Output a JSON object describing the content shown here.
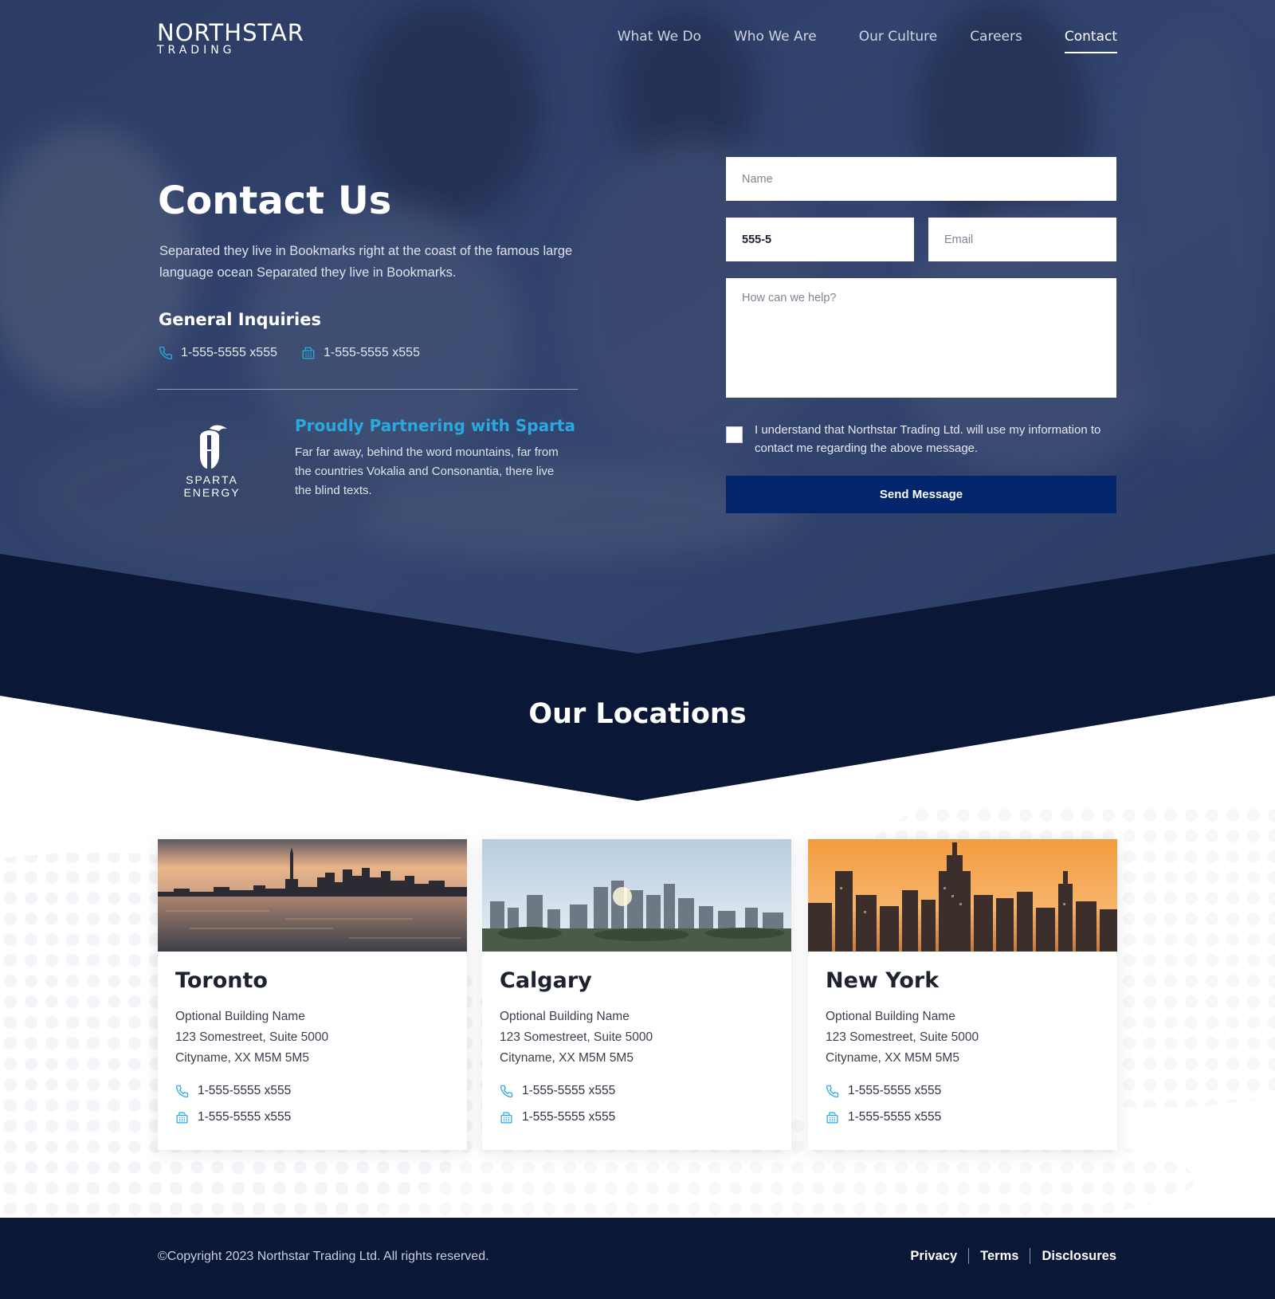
{
  "brand": {
    "name_top": "NORTHSTAR",
    "name_bottom": "TRADING"
  },
  "nav": {
    "items": [
      {
        "label": "What We Do"
      },
      {
        "label": "Who We Are"
      },
      {
        "label": "Our Culture"
      },
      {
        "label": "Careers"
      },
      {
        "label": "Contact",
        "active": true
      }
    ]
  },
  "hero": {
    "title": "Contact Us",
    "lead": "Separated they live in Bookmarks right at the coast of the famous large language ocean Separated they live in Bookmarks.",
    "inquiries_title": "General Inquiries",
    "phone": "1-555-5555 x555",
    "fax": "1-555-5555 x555"
  },
  "partner": {
    "logo_text": "SPARTA ENERGY",
    "title": "Proudly Partnering with Sparta",
    "text": "Far far away, behind the word mountains, far from the countries Vokalia and Consonantia, there live the blind texts."
  },
  "form": {
    "name_placeholder": "Name",
    "phone_value": "555-5",
    "email_placeholder": "Email",
    "message_placeholder": "How can we help?",
    "consent_text": "I understand that Northstar Trading Ltd. will use my information to contact me regarding the above message.",
    "consent_checked": false,
    "submit_label": "Send Message"
  },
  "locations": {
    "title": "Our Locations",
    "cards": [
      {
        "city": "Toronto",
        "building": "Optional Building Name",
        "street": "123 Somestreet, Suite 5000",
        "cityline": "Cityname, XX M5M 5M5",
        "phone": "1-555-5555 x555",
        "fax": "1-555-5555 x555"
      },
      {
        "city": "Calgary",
        "building": "Optional Building Name",
        "street": "123 Somestreet, Suite 5000",
        "cityline": "Cityname, XX M5M 5M5",
        "phone": "1-555-5555 x555",
        "fax": "1-555-5555 x555"
      },
      {
        "city": "New York",
        "building": "Optional Building Name",
        "street": "123 Somestreet, Suite 5000",
        "cityline": "Cityname, XX M5M 5M5",
        "phone": "1-555-5555 x555",
        "fax": "1-555-5555 x555"
      }
    ]
  },
  "footer": {
    "copyright": "©Copyright 2023 Northstar Trading Ltd. All rights reserved.",
    "links": [
      {
        "label": "Privacy"
      },
      {
        "label": "Terms"
      },
      {
        "label": "Disclosures"
      }
    ]
  },
  "icons": {
    "phone": "phone-icon",
    "fax": "fax-icon",
    "logo_star": "star-icon",
    "sparta_helmet": "spartan-helmet-icon"
  },
  "colors": {
    "navy": "#0b1736",
    "hero_overlay": "#1e2d55",
    "button": "#02256b",
    "accent": "#29a9e0",
    "white": "#ffffff"
  }
}
